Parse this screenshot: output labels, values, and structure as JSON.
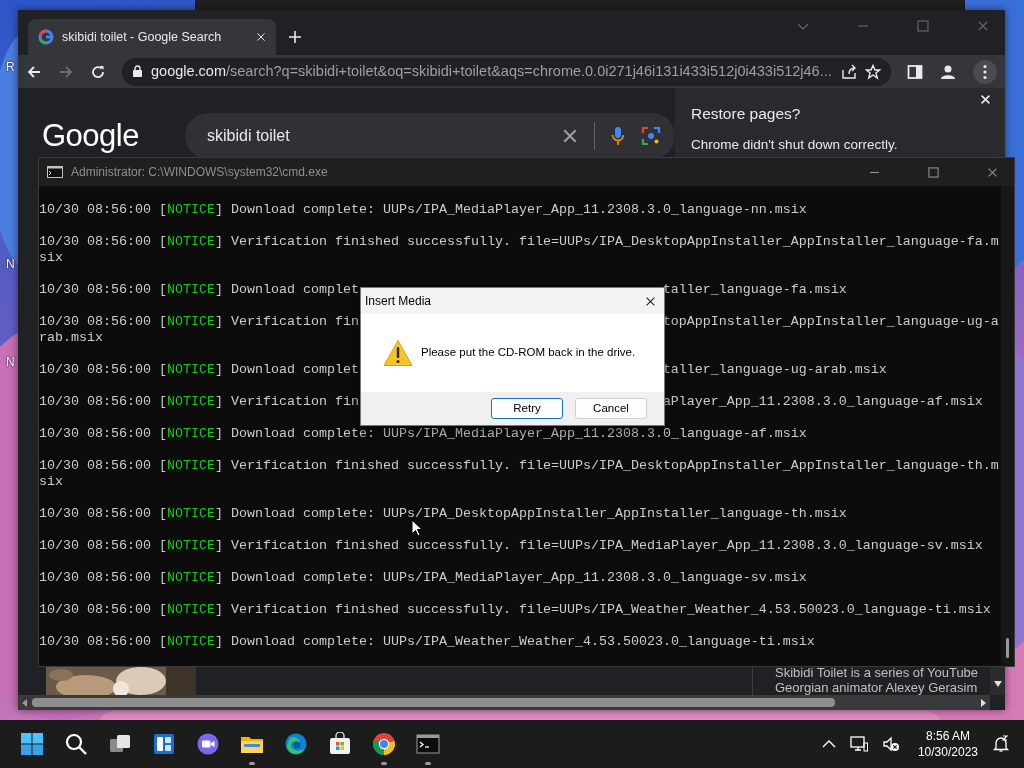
{
  "desktop": {
    "icon_labels": [
      "R",
      "N",
      "N"
    ]
  },
  "browser": {
    "tabs": [
      {
        "title": "skibidi toilet - Google Search",
        "selected": true
      }
    ],
    "nav": {
      "forward_disabled": true
    },
    "address": {
      "host": "google.com",
      "path": "/search?q=skibidi+toilet&oq=skibidi+toilet&aqs=chrome.0.0i271j46i131i433i512j0i433i512j46..."
    },
    "page": {
      "logo": "Google",
      "query": "skibidi toilet",
      "snippet": [
        "Skibidi Toilet is a series of YouTube",
        "Georgian animator Alexey Gerasim"
      ]
    },
    "restore_popup": {
      "title": "Restore pages?",
      "message": "Chrome didn't shut down correctly."
    }
  },
  "console": {
    "title": "Administrator: C:\\WINDOWS\\system32\\cmd.exe",
    "entries": [
      {
        "time": "10/30 08:56:00",
        "open": "[",
        "tag": "NOTICE",
        "close": "]",
        "kind": "notice",
        "message": "Download complete: UUPs/IPA_MediaPlayer_App_11.2308.3.0_language-nn.msix"
      },
      {
        "time": "10/30 08:56:00",
        "open": "[",
        "tag": "NOTICE",
        "close": "]",
        "kind": "notice",
        "message": "Verification finished successfully. file=UUPs/IPA_DesktopAppInstaller_AppInstaller_language-fa.m",
        "wrap": "six"
      },
      {
        "time": "10/30 08:56:00",
        "open": "[",
        "tag": "NOTICE",
        "close": "]",
        "kind": "notice",
        "message": "Download complet",
        "message_right": "taller_language-fa.msix"
      },
      {
        "time": "10/30 08:56:00",
        "open": "[",
        "tag": "NOTICE",
        "close": "]",
        "kind": "notice",
        "message": "Verification fin",
        "message_right": "topAppInstaller_AppInstaller_language-ug-a",
        "wrap": "rab.msix"
      },
      {
        "time": "10/30 08:56:00",
        "open": "[",
        "tag": "NOTICE",
        "close": "]",
        "kind": "notice",
        "message": "Download complet",
        "message_right": "taller_language-ug-arab.msix"
      },
      {
        "time": "10/30 08:56:00",
        "open": "[",
        "tag": "NOTICE",
        "close": "]",
        "kind": "notice",
        "message": "Verification fin",
        "message_right": "aPlayer_App_11.2308.3.0_language-af.msix"
      },
      {
        "time": "10/30 08:56:00",
        "open": "[",
        "tag": "NOTICE",
        "close": "]",
        "kind": "notice",
        "message": "Download complete: UUPs/IPA_MediaPlayer_App_11.2308.3.0_language-af.msix"
      },
      {
        "time": "10/30 08:56:00",
        "open": "[",
        "tag": "NOTICE",
        "close": "]",
        "kind": "notice",
        "message": "Verification finished successfully. file=UUPs/IPA_DesktopAppInstaller_AppInstaller_language-th.m",
        "wrap": "six"
      },
      {
        "time": "10/30 08:56:00",
        "open": "[",
        "tag": "NOTICE",
        "close": "]",
        "kind": "notice",
        "message": "Download complete: UUPs/IPA_DesktopAppInstaller_AppInstaller_language-th.msix"
      },
      {
        "time": "10/30 08:56:00",
        "open": "[",
        "tag": "NOTICE",
        "close": "]",
        "kind": "notice",
        "message": "Verification finished successfully. file=UUPs/IPA_MediaPlayer_App_11.2308.3.0_language-sv.msix"
      },
      {
        "time": "10/30 08:56:00",
        "open": "[",
        "tag": "NOTICE",
        "close": "]",
        "kind": "notice",
        "message": "Download complete: UUPs/IPA_MediaPlayer_App_11.2308.3.0_language-sv.msix"
      },
      {
        "time": "10/30 08:56:00",
        "open": "[",
        "tag": "NOTICE",
        "close": "]",
        "kind": "notice",
        "message": "Verification finished successfully. file=UUPs/IPA_Weather_Weather_4.53.50023.0_language-ti.msix"
      },
      {
        "time": "10/30 08:56:00",
        "open": "[",
        "tag": "NOTICE",
        "close": "]",
        "kind": "notice",
        "message": "Download complete: UUPs/IPA_Weather_Weather_4.53.50023.0_language-ti.msix"
      }
    ]
  },
  "dialog": {
    "title": "Insert Media",
    "message": "Please put the CD-ROM back in the drive.",
    "buttons": [
      {
        "label": "Retry",
        "default": true
      },
      {
        "label": "Cancel",
        "default": false
      }
    ]
  },
  "taskbar": {
    "apps": [
      {
        "kind": "start",
        "running": false
      },
      {
        "kind": "search",
        "running": false
      },
      {
        "kind": "taskview",
        "running": false
      },
      {
        "kind": "widgets",
        "running": false
      },
      {
        "kind": "chat",
        "running": false
      },
      {
        "kind": "explorer",
        "running": true
      },
      {
        "kind": "edge",
        "running": false
      },
      {
        "kind": "store",
        "running": false
      },
      {
        "kind": "chrome",
        "running": true
      },
      {
        "kind": "terminal",
        "running": true
      }
    ],
    "clock": {
      "time": "8:56 AM",
      "date": "10/30/2023"
    }
  }
}
